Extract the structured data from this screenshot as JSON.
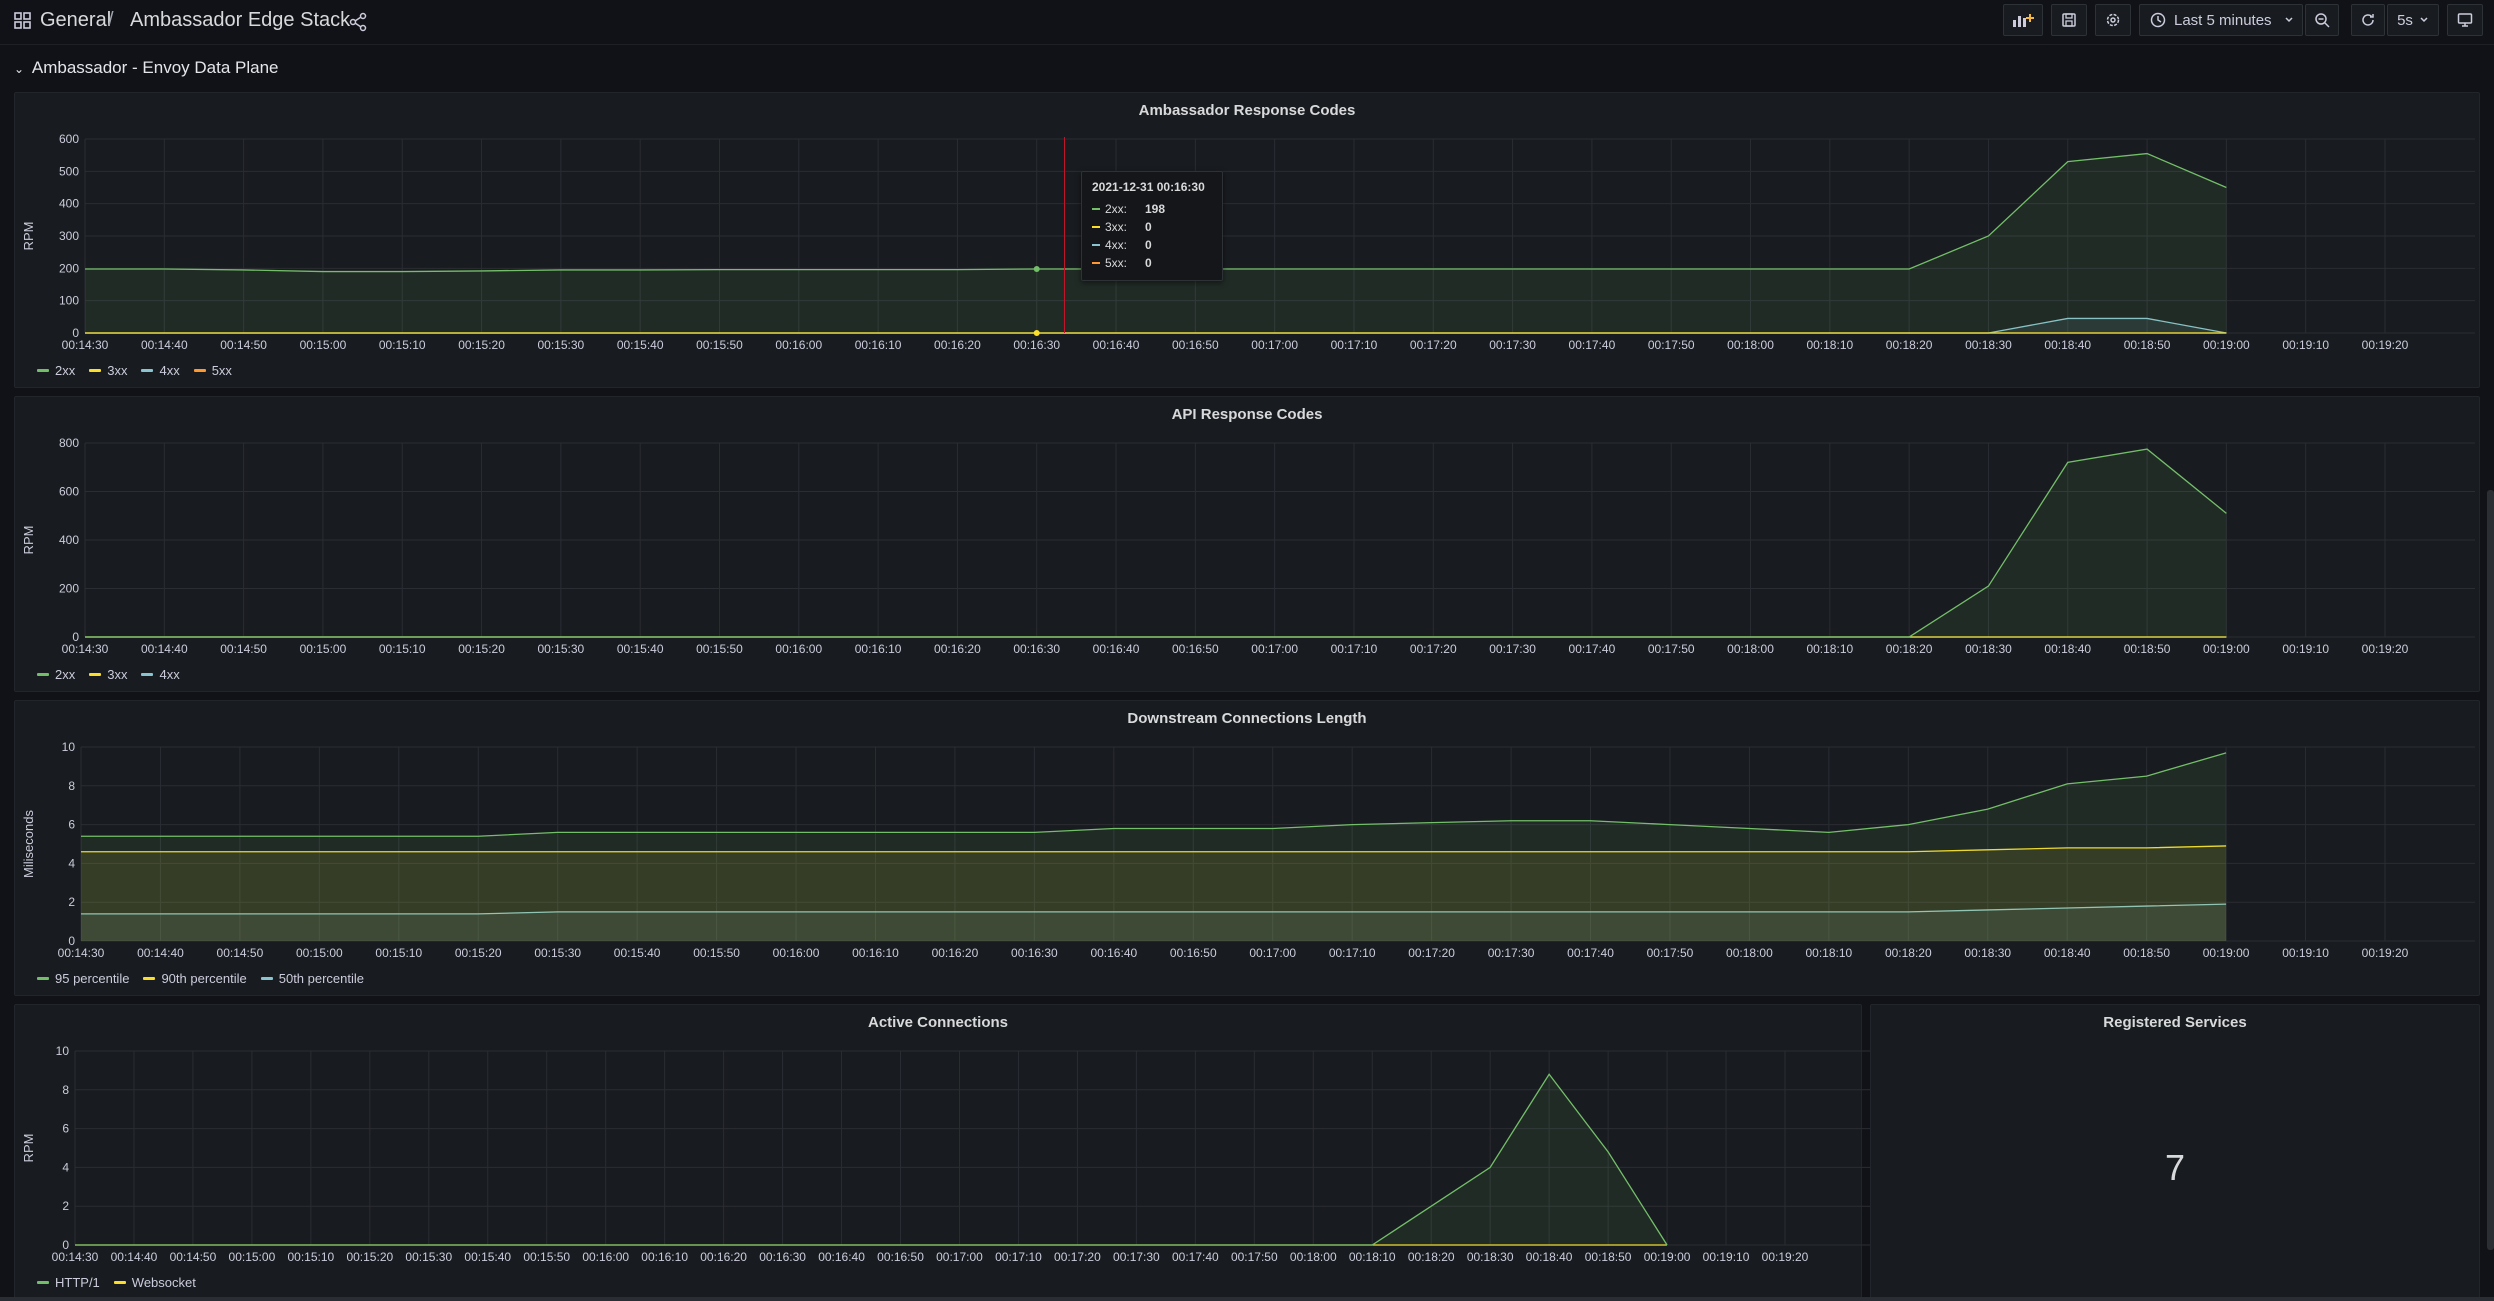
{
  "header": {
    "breadcrumb_root": "General",
    "breadcrumb_sep": "/",
    "dashboard_title": "Ambassador Edge Stack",
    "time_range": "Last 5 minutes",
    "refresh_interval": "5s"
  },
  "row": {
    "title": "Ambassador - Envoy Data Plane"
  },
  "colors": {
    "green": "#73bf69",
    "yellow": "#fade2a",
    "cyan": "#5794f2",
    "teal": "#8ac4d0",
    "orange": "#ff9830",
    "bg": "#111217",
    "panel": "#181b1f",
    "grid": "#2a2d33",
    "crosshair": "#c4162a"
  },
  "panels": {
    "response_codes": {
      "title": "Ambassador Response Codes",
      "tooltip": {
        "time": "2021-12-31 00:16:30",
        "rows": [
          {
            "label": "2xx:",
            "value": "198"
          },
          {
            "label": "3xx:",
            "value": "0"
          },
          {
            "label": "4xx:",
            "value": "0"
          },
          {
            "label": "5xx:",
            "value": "0"
          }
        ]
      },
      "legend": [
        "2xx",
        "3xx",
        "4xx",
        "5xx"
      ]
    },
    "api_codes": {
      "title": "API Response Codes",
      "legend": [
        "2xx",
        "3xx",
        "4xx"
      ]
    },
    "downstream": {
      "title": "Downstream Connections Length",
      "legend": [
        "95 percentile",
        "90th percentile",
        "50th percentile"
      ]
    },
    "active": {
      "title": "Active Connections",
      "legend": [
        "HTTP/1",
        "Websocket"
      ]
    },
    "registered": {
      "title": "Registered Services",
      "value": "7"
    }
  },
  "chart_data": [
    {
      "type": "area",
      "title": "Ambassador Response Codes",
      "ylabel": "RPM",
      "ylim": [
        0,
        600
      ],
      "yticks": [
        0,
        100,
        200,
        300,
        400,
        500,
        600
      ],
      "x": [
        "00:14:30",
        "00:14:40",
        "00:14:50",
        "00:15:00",
        "00:15:10",
        "00:15:20",
        "00:15:30",
        "00:15:40",
        "00:15:50",
        "00:16:00",
        "00:16:10",
        "00:16:20",
        "00:16:30",
        "00:16:40",
        "00:16:50",
        "00:17:00",
        "00:17:10",
        "00:17:20",
        "00:17:30",
        "00:17:40",
        "00:17:50",
        "00:18:00",
        "00:18:10",
        "00:18:20",
        "00:18:30",
        "00:18:40",
        "00:18:50",
        "00:19:00",
        "00:19:10",
        "00:19:20"
      ],
      "series": [
        {
          "name": "2xx",
          "values": [
            198,
            198,
            195,
            190,
            190,
            192,
            195,
            195,
            196,
            196,
            196,
            196,
            198,
            198,
            198,
            198,
            198,
            198,
            198,
            198,
            198,
            198,
            198,
            198,
            300,
            530,
            555,
            450,
            null,
            null
          ]
        },
        {
          "name": "3xx",
          "values": [
            0,
            0,
            0,
            0,
            0,
            0,
            0,
            0,
            0,
            0,
            0,
            0,
            0,
            0,
            0,
            0,
            0,
            0,
            0,
            0,
            0,
            0,
            0,
            0,
            0,
            0,
            0,
            0,
            null,
            null
          ]
        },
        {
          "name": "4xx",
          "values": [
            0,
            0,
            0,
            0,
            0,
            0,
            0,
            0,
            0,
            0,
            0,
            0,
            0,
            0,
            0,
            0,
            0,
            0,
            0,
            0,
            0,
            0,
            0,
            0,
            0,
            45,
            45,
            0,
            null,
            null
          ]
        },
        {
          "name": "5xx",
          "values": [
            0,
            0,
            0,
            0,
            0,
            0,
            0,
            0,
            0,
            0,
            0,
            0,
            0,
            0,
            0,
            0,
            0,
            0,
            0,
            0,
            0,
            0,
            0,
            0,
            0,
            0,
            0,
            0,
            null,
            null
          ]
        }
      ],
      "legend": "bottom-left",
      "grid": true
    },
    {
      "type": "area",
      "title": "API Response Codes",
      "ylabel": "RPM",
      "ylim": [
        0,
        800
      ],
      "yticks": [
        0,
        200,
        400,
        600,
        800
      ],
      "x": [
        "00:14:30",
        "00:14:40",
        "00:14:50",
        "00:15:00",
        "00:15:10",
        "00:15:20",
        "00:15:30",
        "00:15:40",
        "00:15:50",
        "00:16:00",
        "00:16:10",
        "00:16:20",
        "00:16:30",
        "00:16:40",
        "00:16:50",
        "00:17:00",
        "00:17:10",
        "00:17:20",
        "00:17:30",
        "00:17:40",
        "00:17:50",
        "00:18:00",
        "00:18:10",
        "00:18:20",
        "00:18:30",
        "00:18:40",
        "00:18:50",
        "00:19:00",
        "00:19:10",
        "00:19:20"
      ],
      "series": [
        {
          "name": "2xx",
          "values": [
            0,
            0,
            0,
            0,
            0,
            0,
            0,
            0,
            0,
            0,
            0,
            0,
            0,
            0,
            0,
            0,
            0,
            0,
            0,
            0,
            0,
            0,
            0,
            0,
            210,
            720,
            775,
            510,
            null,
            null
          ]
        },
        {
          "name": "3xx",
          "values": [
            0,
            0,
            0,
            0,
            0,
            0,
            0,
            0,
            0,
            0,
            0,
            0,
            0,
            0,
            0,
            0,
            0,
            0,
            0,
            0,
            0,
            0,
            0,
            0,
            0,
            0,
            0,
            0,
            null,
            null
          ]
        },
        {
          "name": "4xx",
          "values": [
            0,
            0,
            0,
            0,
            0,
            0,
            0,
            0,
            0,
            0,
            0,
            0,
            0,
            0,
            0,
            0,
            0,
            0,
            0,
            0,
            0,
            0,
            0,
            0,
            0,
            0,
            0,
            0,
            null,
            null
          ]
        }
      ],
      "legend": "bottom-left",
      "grid": true
    },
    {
      "type": "area",
      "title": "Downstream Connections Length",
      "ylabel": "Miliseconds",
      "ylim": [
        0,
        10
      ],
      "yticks": [
        0,
        2,
        4,
        6,
        8,
        10
      ],
      "x": [
        "00:14:30",
        "00:14:40",
        "00:14:50",
        "00:15:00",
        "00:15:10",
        "00:15:20",
        "00:15:30",
        "00:15:40",
        "00:15:50",
        "00:16:00",
        "00:16:10",
        "00:16:20",
        "00:16:30",
        "00:16:40",
        "00:16:50",
        "00:17:00",
        "00:17:10",
        "00:17:20",
        "00:17:30",
        "00:17:40",
        "00:17:50",
        "00:18:00",
        "00:18:10",
        "00:18:20",
        "00:18:30",
        "00:18:40",
        "00:18:50",
        "00:19:00",
        "00:19:10",
        "00:19:20"
      ],
      "series": [
        {
          "name": "95 percentile",
          "values": [
            5.4,
            5.4,
            5.4,
            5.4,
            5.4,
            5.4,
            5.6,
            5.6,
            5.6,
            5.6,
            5.6,
            5.6,
            5.6,
            5.8,
            5.8,
            5.8,
            6.0,
            6.1,
            6.2,
            6.2,
            6.0,
            5.8,
            5.6,
            6.0,
            6.8,
            8.1,
            8.5,
            9.7,
            null,
            null
          ]
        },
        {
          "name": "90th percentile",
          "values": [
            4.6,
            4.6,
            4.6,
            4.6,
            4.6,
            4.6,
            4.6,
            4.6,
            4.6,
            4.6,
            4.6,
            4.6,
            4.6,
            4.6,
            4.6,
            4.6,
            4.6,
            4.6,
            4.6,
            4.6,
            4.6,
            4.6,
            4.6,
            4.6,
            4.7,
            4.8,
            4.8,
            4.9,
            null,
            null
          ]
        },
        {
          "name": "50th percentile",
          "values": [
            1.4,
            1.4,
            1.4,
            1.4,
            1.4,
            1.4,
            1.5,
            1.5,
            1.5,
            1.5,
            1.5,
            1.5,
            1.5,
            1.5,
            1.5,
            1.5,
            1.5,
            1.5,
            1.5,
            1.5,
            1.5,
            1.5,
            1.5,
            1.5,
            1.6,
            1.7,
            1.8,
            1.9,
            null,
            null
          ]
        }
      ],
      "legend": "bottom-left",
      "grid": true
    },
    {
      "type": "area",
      "title": "Active Connections",
      "ylabel": "RPM",
      "ylim": [
        0,
        10
      ],
      "yticks": [
        0,
        2,
        4,
        6,
        8,
        10
      ],
      "x": [
        "00:14:30",
        "00:14:40",
        "00:14:50",
        "00:15:00",
        "00:15:10",
        "00:15:20",
        "00:15:30",
        "00:15:40",
        "00:15:50",
        "00:16:00",
        "00:16:10",
        "00:16:20",
        "00:16:30",
        "00:16:40",
        "00:16:50",
        "00:17:00",
        "00:17:10",
        "00:17:20",
        "00:17:30",
        "00:17:40",
        "00:17:50",
        "00:18:00",
        "00:18:10",
        "00:18:20",
        "00:18:30",
        "00:18:40",
        "00:18:50",
        "00:19:00",
        "00:19:10",
        "00:19:20"
      ],
      "series": [
        {
          "name": "HTTP/1",
          "values": [
            0,
            0,
            0,
            0,
            0,
            0,
            0,
            0,
            0,
            0,
            0,
            0,
            0,
            0,
            0,
            0,
            0,
            0,
            0,
            0,
            0,
            0,
            0,
            null,
            4,
            8.8,
            4.8,
            0,
            null,
            null
          ]
        },
        {
          "name": "Websocket",
          "values": [
            0,
            0,
            0,
            0,
            0,
            0,
            0,
            0,
            0,
            0,
            0,
            0,
            0,
            0,
            0,
            0,
            0,
            0,
            0,
            0,
            0,
            0,
            0,
            0,
            0,
            0,
            0,
            0,
            null,
            null
          ]
        }
      ],
      "legend": "bottom-left",
      "grid": true
    }
  ]
}
